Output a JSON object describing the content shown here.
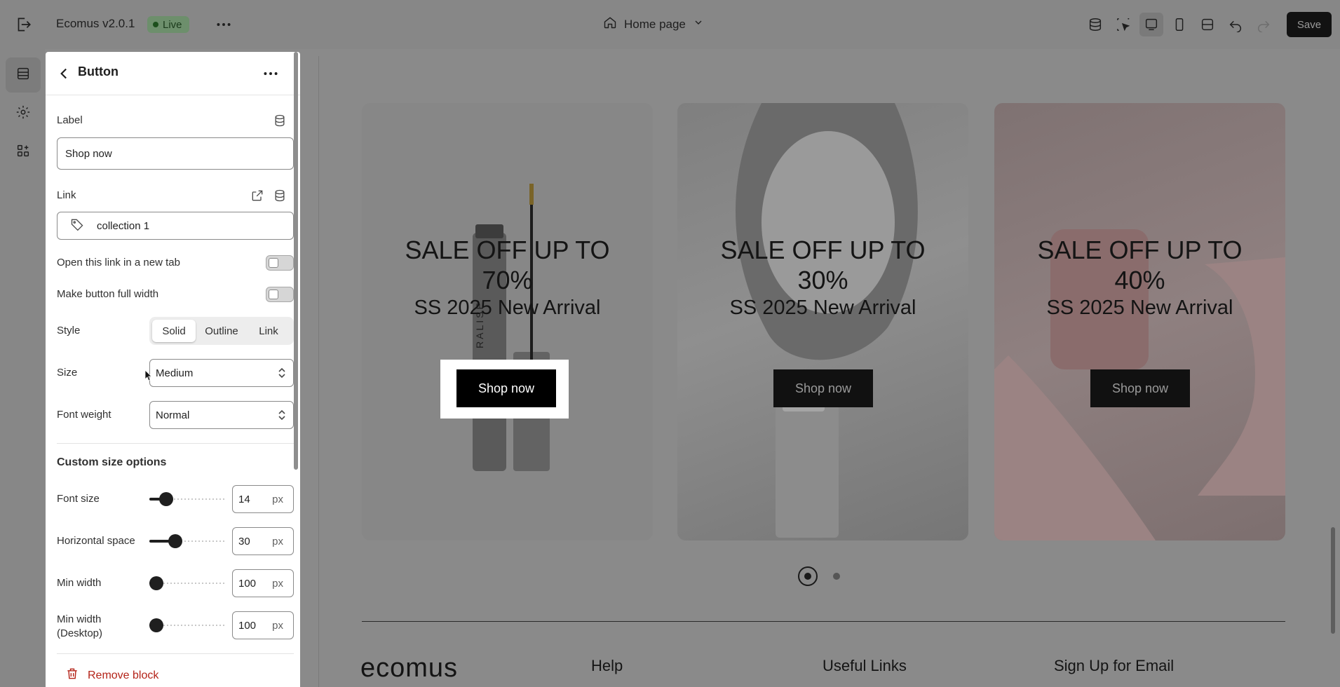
{
  "topbar": {
    "app_title": "Ecomus v2.0.1",
    "live_badge": "Live",
    "page_selector": "Home page",
    "save_label": "Save"
  },
  "rail": {
    "items": [
      "sections",
      "settings",
      "apps"
    ]
  },
  "panel": {
    "title": "Button",
    "label_field": {
      "label": "Label",
      "value": "Shop now"
    },
    "link_field": {
      "label": "Link",
      "value": "collection 1"
    },
    "open_new_tab": {
      "label": "Open this link in a new tab",
      "enabled": false
    },
    "full_width": {
      "label": "Make button full width",
      "enabled": false
    },
    "style": {
      "label": "Style",
      "options": [
        "Solid",
        "Outline",
        "Link"
      ],
      "selected": "Solid"
    },
    "size": {
      "label": "Size",
      "value": "Medium"
    },
    "font_weight": {
      "label": "Font weight",
      "value": "Normal"
    },
    "custom_size": {
      "title": "Custom size options",
      "font_size": {
        "label": "Font size",
        "value": "14",
        "unit": "px",
        "fraction": 0.15
      },
      "horizontal_space": {
        "label": "Horizontal space",
        "value": "30",
        "unit": "px",
        "fraction": 0.3
      },
      "min_width": {
        "label": "Min width",
        "value": "100",
        "unit": "px",
        "fraction": 0.0
      },
      "min_width_desktop": {
        "label": "Min width",
        "label_line2": "(Desktop)",
        "value": "100",
        "unit": "px",
        "fraction": 0.0
      }
    },
    "remove_label": "Remove block"
  },
  "preview": {
    "cards": [
      {
        "title_line1": "SALE OFF UP TO",
        "title_line2": "70%",
        "subtitle": "SS 2025 New Arrival",
        "button": "Shop now",
        "product_text": "RALISE"
      },
      {
        "title_line1": "SALE OFF UP TO",
        "title_line2": "30%",
        "subtitle": "SS 2025 New Arrival",
        "button": "Shop now"
      },
      {
        "title_line1": "SALE OFF UP TO",
        "title_line2": "40%",
        "subtitle": "SS 2025 New Arrival",
        "button": "Shop now"
      }
    ],
    "pagination": {
      "count": 2,
      "active": 1
    },
    "footer": {
      "brand": "ecomus",
      "columns": [
        "Help",
        "Useful Links",
        "Sign Up for Email"
      ]
    }
  },
  "colors": {
    "overlay": "#878787",
    "panel_bg": "#ffffff",
    "remove_red": "#b42318",
    "live_green": "#6d8f6c"
  }
}
